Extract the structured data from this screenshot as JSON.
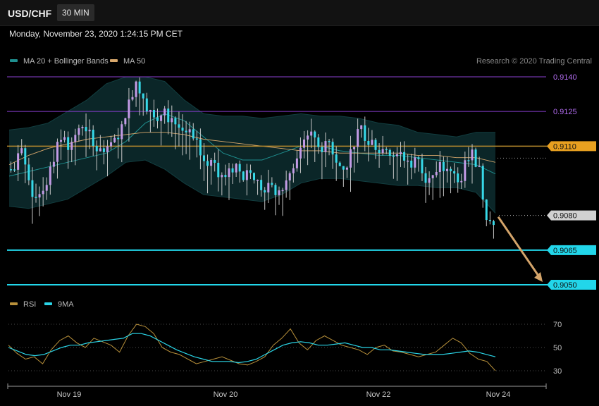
{
  "header": {
    "symbol": "USD/CHF",
    "timeframe": "30 MIN",
    "datetime": "Monday, November 23, 2020 1:24:15 PM CET"
  },
  "legend": {
    "main": [
      {
        "label": "MA 20 + Bollinger Bands",
        "color": "#1f8f8f"
      },
      {
        "label": "MA 50",
        "color": "#d9a86c"
      }
    ],
    "rsi": [
      {
        "label": "RSI",
        "color": "#b8903a"
      },
      {
        "label": "9MA",
        "color": "#2ad4e6"
      }
    ],
    "copyright": "Research © 2020 Trading Central"
  },
  "colors": {
    "bull": "#c39be6",
    "bear": "#37d9e8",
    "band": "#0c2a2c",
    "ma20": "#1f8f8f",
    "ma50": "#d9a86c",
    "resistance": "#8a3fd1",
    "resistance_text": "#b26cf0",
    "pivot": "#e8a020",
    "support": "#22d6ea",
    "current": "#d0d0d0",
    "arrow": "#d4a46a",
    "rsi": "#b8903a",
    "rsi_ma": "#2ad4e6"
  },
  "chart_data": [
    {
      "type": "candlestick",
      "title": "USD/CHF",
      "ylim": [
        0.903,
        0.915
      ],
      "x_labels": [
        "Nov 19",
        "Nov 20",
        "Nov 22",
        "Nov 24"
      ],
      "levels": [
        {
          "value": 0.914,
          "label": "0.9140",
          "kind": "resistance"
        },
        {
          "value": 0.9125,
          "label": "0.9125",
          "kind": "resistance"
        },
        {
          "value": 0.911,
          "label": "0.9110",
          "kind": "pivot"
        },
        {
          "value": 0.908,
          "label": "0.9080",
          "kind": "current"
        },
        {
          "value": 0.9065,
          "label": "0.9065",
          "kind": "support"
        },
        {
          "value": 0.905,
          "label": "0.9050",
          "kind": "support"
        }
      ],
      "forecast_arrow": {
        "from": 0.908,
        "to": 0.905
      },
      "close_path": [
        0.91,
        0.9108,
        0.9095,
        0.9088,
        0.9092,
        0.91,
        0.9112,
        0.9115,
        0.911,
        0.9118,
        0.9115,
        0.9112,
        0.911,
        0.9108,
        0.9112,
        0.9118,
        0.913,
        0.9138,
        0.9132,
        0.9126,
        0.912,
        0.9128,
        0.9122,
        0.9118,
        0.9116,
        0.9112,
        0.9105,
        0.9102,
        0.9104,
        0.9098,
        0.91,
        0.9102,
        0.9096,
        0.91,
        0.9094,
        0.909,
        0.9092,
        0.9089,
        0.9094,
        0.91,
        0.9108,
        0.9116,
        0.9114,
        0.9108,
        0.9112,
        0.9104,
        0.91,
        0.9108,
        0.9116,
        0.9114,
        0.9112,
        0.9108,
        0.911,
        0.9106,
        0.9108,
        0.9104,
        0.9104,
        0.91,
        0.9098,
        0.9098,
        0.91,
        0.9098,
        0.9096,
        0.9102,
        0.9108,
        0.91,
        0.908,
        0.9076
      ],
      "ma20": [
        0.9097,
        0.9099,
        0.9101,
        0.9103,
        0.9105,
        0.9107,
        0.9112,
        0.912,
        0.9124,
        0.9121,
        0.9114,
        0.9107,
        0.9104,
        0.9104,
        0.9107,
        0.911,
        0.911,
        0.9108,
        0.9107,
        0.9106,
        0.9106,
        0.9105,
        0.9104,
        0.9103,
        0.9102,
        0.9098
      ],
      "ma50": [
        0.9102,
        0.9106,
        0.9109,
        0.9111,
        0.9113,
        0.9114,
        0.9115,
        0.9116,
        0.9116,
        0.9115,
        0.9113,
        0.9112,
        0.9111,
        0.911,
        0.9109,
        0.9108,
        0.9108,
        0.9107,
        0.9107,
        0.9107,
        0.9107,
        0.9106,
        0.9106,
        0.9105,
        0.9105,
        0.9103
      ],
      "bb_upper": [
        0.9117,
        0.9118,
        0.912,
        0.9125,
        0.913,
        0.9137,
        0.914,
        0.914,
        0.9138,
        0.913,
        0.9124,
        0.9123,
        0.9123,
        0.9122,
        0.9123,
        0.9124,
        0.9123,
        0.9123,
        0.9122,
        0.912,
        0.9119,
        0.9116,
        0.9115,
        0.9114,
        0.9116,
        0.9116
      ],
      "bb_lower": [
        0.9084,
        0.9083,
        0.9085,
        0.9087,
        0.9092,
        0.9097,
        0.9103,
        0.9104,
        0.91,
        0.9094,
        0.9089,
        0.9088,
        0.9087,
        0.9086,
        0.9089,
        0.9094,
        0.9096,
        0.9096,
        0.9095,
        0.9094,
        0.9093,
        0.9093,
        0.9092,
        0.9092,
        0.909,
        0.9081
      ]
    },
    {
      "type": "line",
      "title": "RSI",
      "ylim": [
        20,
        80
      ],
      "y_ticks": [
        70,
        50,
        30
      ],
      "series": [
        {
          "name": "RSI",
          "values": [
            52,
            45,
            40,
            42,
            36,
            48,
            56,
            60,
            54,
            50,
            58,
            55,
            52,
            46,
            60,
            70,
            68,
            62,
            50,
            46,
            44,
            40,
            36,
            38,
            40,
            42,
            39,
            36,
            35,
            38,
            42,
            52,
            58,
            66,
            54,
            48,
            56,
            60,
            56,
            52,
            50,
            48,
            44,
            50,
            52,
            47,
            46,
            44,
            42,
            44,
            46,
            52,
            58,
            54,
            45,
            40,
            38,
            30
          ]
        },
        {
          "name": "9MA",
          "values": [
            50,
            47,
            44,
            43,
            44,
            47,
            50,
            52,
            52,
            54,
            55,
            56,
            57,
            58,
            62,
            62,
            60,
            56,
            52,
            48,
            45,
            42,
            40,
            38,
            38,
            38,
            37,
            38,
            40,
            44,
            48,
            52,
            54,
            55,
            54,
            52,
            52,
            53,
            54,
            52,
            50,
            50,
            48,
            48,
            47,
            46,
            45,
            44,
            44,
            44,
            45,
            46,
            47,
            46,
            44,
            42
          ]
        }
      ]
    }
  ]
}
